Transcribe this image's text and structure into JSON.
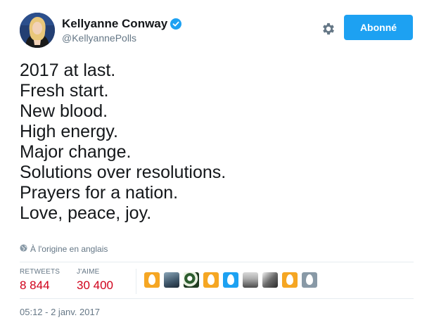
{
  "user": {
    "name": "Kellyanne Conway",
    "handle": "@KellyannePolls",
    "verified": true
  },
  "actions": {
    "follow_label": "Abonné"
  },
  "tweet": {
    "lines": [
      "2017 at last.",
      "Fresh start.",
      "New blood.",
      "High energy.",
      "Major change.",
      "Solutions over resolutions.",
      "Prayers for a nation.",
      "Love, peace, joy."
    ],
    "translation_note": "À l'origine en anglais",
    "timestamp": "05:12 - 2 janv. 2017"
  },
  "stats": {
    "retweets_label": "RETWEETS",
    "retweets_value": "8 844",
    "likes_label": "J'AIME",
    "likes_value": "30 400"
  },
  "likers": [
    "egg-orange",
    "photo",
    "photo",
    "egg-orange",
    "egg-blue",
    "photo",
    "photo",
    "egg-orange",
    "egg-gray"
  ],
  "colors": {
    "accent": "#1da1f2",
    "count": "#d0021b",
    "muted": "#657786"
  }
}
